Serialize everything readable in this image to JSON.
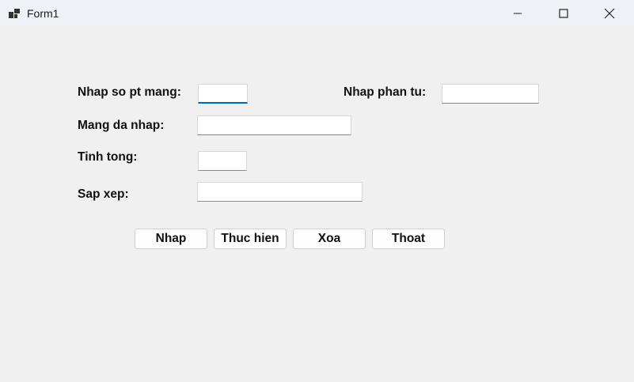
{
  "window": {
    "title": "Form1",
    "icon": "winforms-app-icon",
    "controls": [
      "minimize-icon",
      "maximize-icon",
      "close-icon"
    ]
  },
  "form": {
    "array_size": {
      "label": "Nhap so pt mang:",
      "value": ""
    },
    "element": {
      "label": "Nhap phan tu:",
      "value": ""
    },
    "entered_array": {
      "label": "Mang da nhap:",
      "value": ""
    },
    "sum": {
      "label": "Tinh tong:",
      "value": ""
    },
    "sorted": {
      "label": "Sap xep:",
      "value": ""
    }
  },
  "buttons": {
    "nhap": "Nhap",
    "thuc_hien": "Thuc hien",
    "xoa": "Xoa",
    "thoat": "Thoat"
  },
  "colors": {
    "titlebar": "#eef2f7",
    "client": "#f0f0f0",
    "focus_accent": "#0067c0"
  }
}
